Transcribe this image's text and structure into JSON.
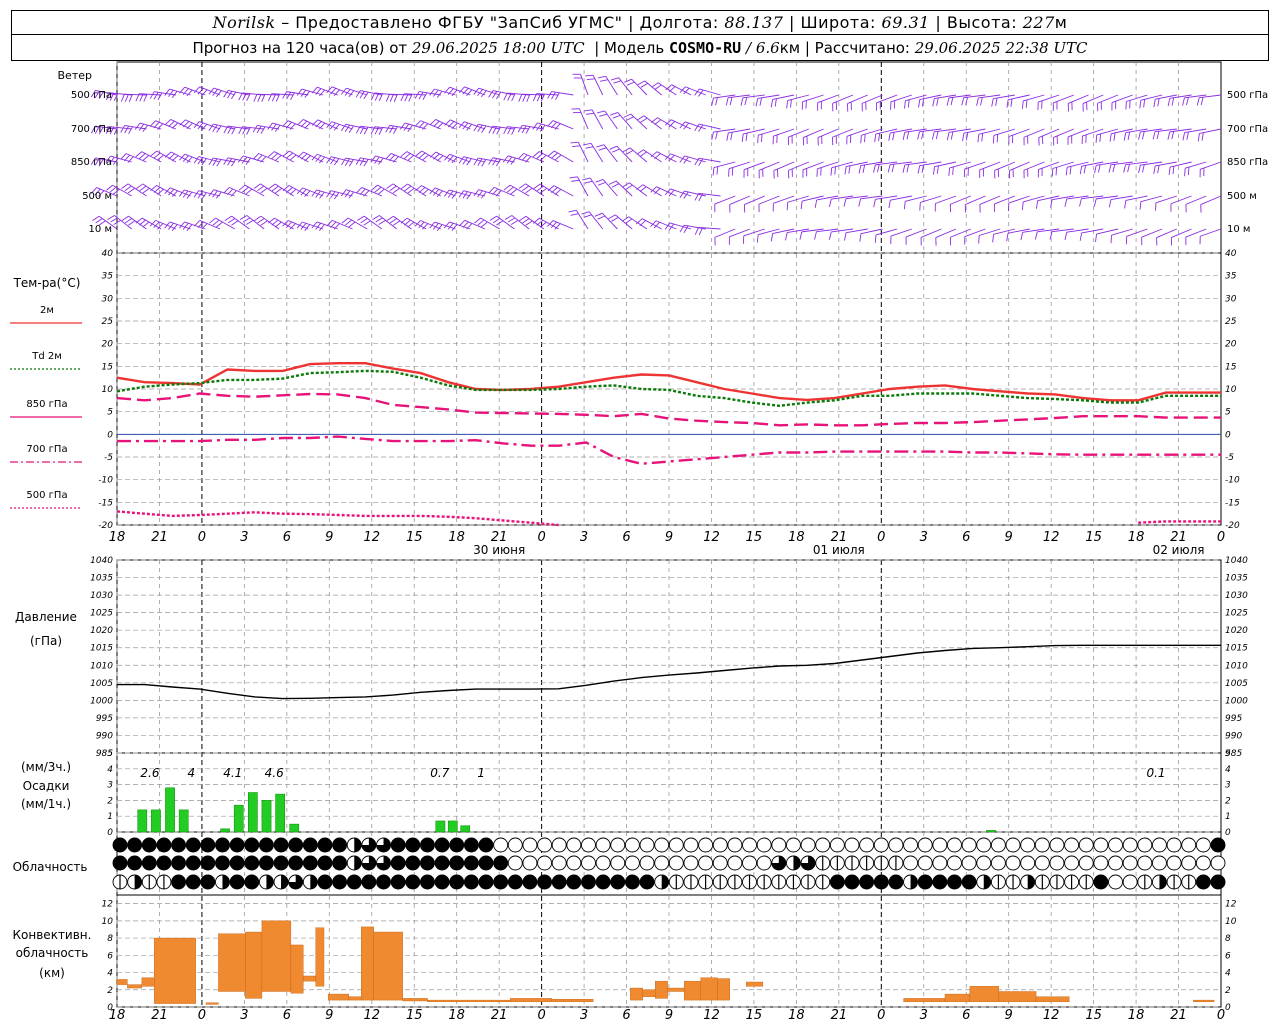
{
  "header": {
    "city": "Norilsk",
    "provider": "– Предоставлено ФГБУ \"ЗапСиб УГМС\"",
    "lon_label": "Долгота:",
    "lon_value": "88.137",
    "lat_label": "Широта:",
    "lat_value": "69.31",
    "alt_label": "Высота:",
    "alt_value": "227",
    "alt_unit": "м",
    "forecast_label": "Прогноз на 120 часа(ов) от",
    "forecast_start": "29.06.2025 18:00 UTC",
    "model_label": "Модель",
    "model_name": "COSMO-RU",
    "model_res": "/ 6.6",
    "model_res_unit": "км",
    "calc_label": "Рассчитано:",
    "calc_time": "29.06.2025 22:38 UTC"
  },
  "colors": {
    "wind": "#8a2be2",
    "t2m": "#ee3333",
    "td": "#0a7a0a",
    "levels": "#e8137a",
    "pressure": "#000000",
    "precip": "#22cc22",
    "convective": "#f08a30",
    "grid": "#999999"
  },
  "hour_ticks": [
    "18",
    "21",
    "0",
    "3",
    "6",
    "9",
    "12",
    "15",
    "18",
    "21",
    "0",
    "3",
    "6",
    "9",
    "12",
    "15",
    "18",
    "21",
    "0",
    "3",
    "6",
    "9",
    "12",
    "15",
    "18",
    "21",
    "0"
  ],
  "day_labels": [
    {
      "at": 8,
      "label": "30 июня"
    },
    {
      "at": 16,
      "label": "01 июля"
    },
    {
      "at": 24,
      "label": "02 июля"
    }
  ],
  "wind_panel": {
    "title": "Ветер",
    "levels": [
      "500 гПа",
      "700 гПа",
      "850 гПа",
      "500 м",
      "10 м"
    ]
  },
  "temp_panel": {
    "title": "Тем-ра(°С)",
    "legend": [
      {
        "label": "2м",
        "style": "solid",
        "color": "#ee3333"
      },
      {
        "label": "Td 2м",
        "style": "dotted",
        "color": "#0a7a0a"
      },
      {
        "label": "850 гПа",
        "style": "solid",
        "color": "#e8137a"
      },
      {
        "label": "700 гПа",
        "style": "dashdot",
        "color": "#e8137a"
      },
      {
        "label": "500 гПа",
        "style": "dotted",
        "color": "#e8137a"
      }
    ],
    "yticks": [
      "40",
      "35",
      "30",
      "25",
      "20",
      "15",
      "10",
      "5",
      "0",
      "-5",
      "-10",
      "-15",
      "-20"
    ]
  },
  "pressure_panel": {
    "title1": "Давление",
    "title2": "(гПа)",
    "yticks": [
      "1040",
      "1035",
      "1030",
      "1025",
      "1020",
      "1015",
      "1010",
      "1005",
      "1000",
      "995",
      "990",
      "985"
    ]
  },
  "precip_panel": {
    "title1": "(мм/3ч.)",
    "title2": "Осадки",
    "title3": "(мм/1ч.)",
    "yticks": [
      "5",
      "4",
      "3",
      "2",
      "1",
      "0"
    ],
    "totals": [
      {
        "at": 0.7,
        "label": "2.6"
      },
      {
        "at": 1.7,
        "label": "4"
      },
      {
        "at": 2.7,
        "label": "4.1"
      },
      {
        "at": 3.7,
        "label": "4.6"
      },
      {
        "at": 7.7,
        "label": "0.7"
      },
      {
        "at": 8.7,
        "label": "1"
      },
      {
        "at": 25.0,
        "label": "0.1"
      }
    ]
  },
  "cloud_panel": {
    "title": "Облачность"
  },
  "conv_panel": {
    "title1": "Конвективн.",
    "title2": "облачность",
    "title3": "(км)",
    "yticks": [
      "12",
      "10",
      "8",
      "6",
      "4",
      "2",
      "0"
    ]
  },
  "chart_data": {
    "type": "line",
    "x_unit": "3-hour steps from 29.06.2025 18:00 UTC",
    "x": [
      0,
      1,
      2,
      3,
      4,
      5,
      6,
      7,
      8,
      9,
      10,
      11,
      12,
      13,
      14,
      15,
      16,
      17,
      18,
      19,
      20,
      21,
      22,
      23,
      24,
      25,
      26,
      27,
      28,
      29,
      30,
      31,
      32,
      33,
      34,
      35,
      36,
      37,
      38,
      39,
      40
    ],
    "series": [
      {
        "name": "2м",
        "values": [
          12.5,
          11.5,
          11.3,
          11.0,
          14.3,
          14.0,
          14.0,
          15.5,
          15.7,
          15.7,
          14.5,
          13.5,
          11.5,
          10.0,
          9.8,
          10.0,
          10.5,
          11.5,
          12.5,
          13.2,
          13.0,
          11.5,
          10.0,
          9.0,
          8.0,
          7.6,
          8.0,
          9.0,
          10.0,
          10.5,
          10.8,
          10.0,
          9.5,
          9.0,
          8.8,
          8.0,
          7.5,
          7.5,
          9.2,
          9.2,
          9.2
        ]
      },
      {
        "name": "Td 2м",
        "values": [
          9.5,
          10.5,
          11.0,
          11.3,
          12.0,
          12.0,
          12.3,
          13.5,
          13.7,
          14.0,
          13.8,
          12.5,
          10.8,
          9.8,
          9.8,
          9.8,
          10.0,
          10.5,
          10.8,
          10.0,
          9.8,
          8.5,
          8.0,
          7.0,
          6.3,
          7.0,
          7.5,
          8.5,
          8.5,
          9.0,
          9.0,
          9.0,
          8.5,
          8.0,
          7.8,
          7.5,
          7.0,
          7.0,
          8.5,
          8.5,
          8.5
        ]
      },
      {
        "name": "850 гПа",
        "values": [
          8.0,
          7.5,
          8.0,
          9.0,
          8.5,
          8.3,
          8.6,
          8.9,
          8.8,
          8.0,
          6.5,
          6.0,
          5.5,
          4.8,
          4.7,
          4.6,
          4.5,
          4.3,
          4.0,
          4.5,
          3.5,
          3.0,
          2.7,
          2.5,
          2.0,
          2.2,
          2.0,
          2.0,
          2.3,
          2.5,
          2.5,
          2.7,
          3.0,
          3.3,
          3.6,
          4.0,
          4.0,
          4.0,
          3.7,
          3.7,
          3.7
        ]
      },
      {
        "name": "700 гПа",
        "values": [
          -1.5,
          -1.5,
          -1.5,
          -1.5,
          -1.2,
          -1.2,
          -0.8,
          -0.8,
          -0.5,
          -1.0,
          -1.5,
          -1.5,
          -1.5,
          -1.3,
          -2.0,
          -2.5,
          -2.5,
          -1.8,
          -5.0,
          -6.5,
          -6.0,
          -5.5,
          -5.0,
          -4.5,
          -4.0,
          -4.0,
          -3.8,
          -3.8,
          -3.8,
          -3.8,
          -3.8,
          -4.0,
          -4.0,
          -4.2,
          -4.4,
          -4.5,
          -4.5,
          -4.5,
          -4.5,
          -4.5,
          -4.5
        ]
      },
      {
        "name": "500 гПа",
        "values": [
          -17.0,
          -17.5,
          -18.0,
          -17.8,
          -17.5,
          -17.2,
          -17.5,
          -17.6,
          -17.8,
          -18.0,
          -18.0,
          -18.0,
          -18.2,
          -18.5,
          -19.0,
          -19.5,
          -20.0,
          -21,
          -21,
          -21,
          -21,
          -21,
          -21,
          -21,
          -21,
          -21,
          -21,
          -21,
          -21,
          -21,
          -21,
          -21,
          -21,
          -21,
          -21,
          -21,
          -21,
          -19.5,
          -19.2,
          -19.2,
          -19.2
        ]
      }
    ],
    "pressure": [
      1004.5,
      1004.5,
      1003.8,
      1003.2,
      1002.0,
      1001.0,
      1000.5,
      1000.6,
      1000.8,
      1001.0,
      1001.5,
      1002.3,
      1002.8,
      1003.2,
      1003.2,
      1003.2,
      1003.3,
      1004.3,
      1005.5,
      1006.5,
      1007.2,
      1007.8,
      1008.5,
      1009.2,
      1009.8,
      1010.0,
      1010.5,
      1011.5,
      1012.5,
      1013.5,
      1014.2,
      1014.8,
      1015.0,
      1015.3,
      1015.6,
      1015.7,
      1015.7,
      1015.7,
      1015.7,
      1015.7,
      1015.7
    ],
    "precip_1h": [
      {
        "x": 0.5,
        "v": 1.4
      },
      {
        "x": 0.83,
        "v": 1.4
      },
      {
        "x": 1.17,
        "v": 2.8
      },
      {
        "x": 1.5,
        "v": 1.4
      },
      {
        "x": 2.5,
        "v": 0.2
      },
      {
        "x": 2.83,
        "v": 1.7
      },
      {
        "x": 3.17,
        "v": 2.5
      },
      {
        "x": 3.5,
        "v": 2.0
      },
      {
        "x": 3.83,
        "v": 2.4
      },
      {
        "x": 4.17,
        "v": 0.5
      },
      {
        "x": 7.7,
        "v": 0.7
      },
      {
        "x": 8.0,
        "v": 0.7
      },
      {
        "x": 8.3,
        "v": 0.4
      },
      {
        "x": 21.0,
        "v": 0.1
      }
    ],
    "convective_cloud": [
      {
        "x0": 0.0,
        "x1": 0.25,
        "bottom": 2.6,
        "top": 3.2
      },
      {
        "x0": 0.25,
        "x1": 0.6,
        "bottom": 2.2,
        "top": 2.6
      },
      {
        "x0": 0.6,
        "x1": 0.9,
        "bottom": 2.4,
        "top": 3.4
      },
      {
        "x0": 0.9,
        "x1": 1.9,
        "bottom": 0.4,
        "top": 8.0
      },
      {
        "x0": 2.15,
        "x1": 2.45,
        "bottom": 0.3,
        "top": 0.5
      },
      {
        "x0": 2.45,
        "x1": 3.1,
        "bottom": 1.8,
        "top": 8.5
      },
      {
        "x0": 3.1,
        "x1": 3.5,
        "bottom": 1.0,
        "top": 8.7
      },
      {
        "x0": 3.5,
        "x1": 4.2,
        "bottom": 1.8,
        "top": 10.0
      },
      {
        "x0": 4.2,
        "x1": 4.5,
        "bottom": 1.6,
        "top": 7.2
      },
      {
        "x0": 4.5,
        "x1": 4.8,
        "bottom": 3.0,
        "top": 3.6
      },
      {
        "x0": 4.8,
        "x1": 5.0,
        "bottom": 2.4,
        "top": 9.2
      },
      {
        "x0": 5.1,
        "x1": 5.6,
        "bottom": 0.8,
        "top": 1.5
      },
      {
        "x0": 5.6,
        "x1": 5.9,
        "bottom": 0.8,
        "top": 1.2
      },
      {
        "x0": 5.9,
        "x1": 6.2,
        "bottom": 0.8,
        "top": 9.3
      },
      {
        "x0": 6.2,
        "x1": 6.9,
        "bottom": 0.8,
        "top": 8.7
      },
      {
        "x0": 6.9,
        "x1": 7.5,
        "bottom": 0.7,
        "top": 1.0
      },
      {
        "x0": 7.5,
        "x1": 9.5,
        "bottom": 0.6,
        "top": 0.8
      },
      {
        "x0": 9.5,
        "x1": 10.5,
        "bottom": 0.6,
        "top": 1.0
      },
      {
        "x0": 10.5,
        "x1": 11.5,
        "bottom": 0.6,
        "top": 0.9
      },
      {
        "x0": 12.4,
        "x1": 12.7,
        "bottom": 0.8,
        "top": 2.2
      },
      {
        "x0": 12.7,
        "x1": 13.0,
        "bottom": 1.2,
        "top": 2.0
      },
      {
        "x0": 13.0,
        "x1": 13.3,
        "bottom": 1.0,
        "top": 3.0
      },
      {
        "x0": 13.3,
        "x1": 13.7,
        "bottom": 1.8,
        "top": 2.2
      },
      {
        "x0": 13.7,
        "x1": 14.1,
        "bottom": 0.8,
        "top": 3.0
      },
      {
        "x0": 14.1,
        "x1": 14.5,
        "bottom": 0.8,
        "top": 3.4
      },
      {
        "x0": 14.5,
        "x1": 14.8,
        "bottom": 0.8,
        "top": 3.3
      },
      {
        "x0": 15.2,
        "x1": 15.6,
        "bottom": 2.4,
        "top": 2.9
      },
      {
        "x0": 19.0,
        "x1": 20.0,
        "bottom": 0.6,
        "top": 1.0
      },
      {
        "x0": 20.0,
        "x1": 20.6,
        "bottom": 0.6,
        "top": 1.5
      },
      {
        "x0": 20.6,
        "x1": 21.3,
        "bottom": 0.6,
        "top": 2.4
      },
      {
        "x0": 21.3,
        "x1": 22.2,
        "bottom": 0.6,
        "top": 1.8
      },
      {
        "x0": 22.2,
        "x1": 23.0,
        "bottom": 0.6,
        "top": 1.2
      },
      {
        "x0": 26.0,
        "x1": 26.5,
        "bottom": 0.6,
        "top": 0.8
      }
    ],
    "ylim_temp": [
      -20,
      40
    ],
    "ylim_pressure": [
      985,
      1040
    ],
    "ylim_precip": [
      0,
      5
    ],
    "ylim_conv": [
      0,
      13
    ]
  }
}
